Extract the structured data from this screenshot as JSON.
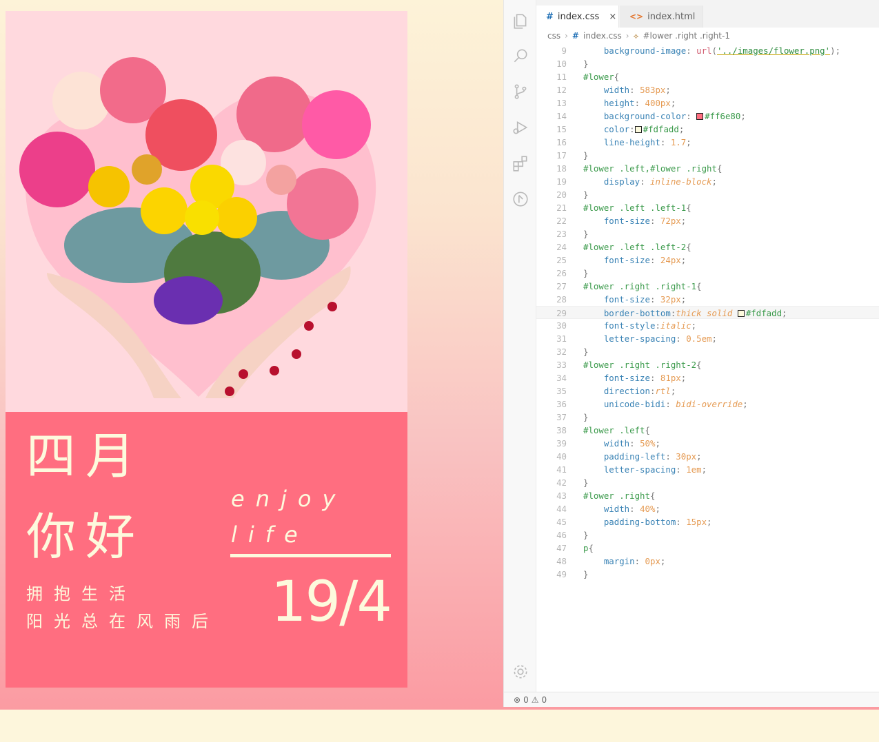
{
  "preview": {
    "left_1": [
      "四月",
      "你好"
    ],
    "left_2": [
      "拥抱生活",
      "阳光总在风雨后"
    ],
    "right_1": [
      "enjoy",
      "life"
    ],
    "right_2": "19/4",
    "colors": {
      "photo_bg": "#ffd9de",
      "card_bg": "#ff6e80",
      "text": "#fdfadd"
    }
  },
  "editor": {
    "tabs": [
      {
        "icon": "#",
        "label": "index.css",
        "close": "×",
        "active": true
      },
      {
        "icon": "<>",
        "label": "index.html",
        "active": false
      }
    ],
    "breadcrumb": [
      "css",
      "index.css",
      "#lower .right .right-1"
    ],
    "lines": [
      {
        "n": "9",
        "tokens": [
          [
            "prop",
            "    background-image"
          ],
          [
            "pun",
            ": "
          ],
          [
            "fn",
            "url"
          ],
          [
            "pun",
            "("
          ],
          [
            "str",
            "'../images/flower.png'"
          ],
          [
            "pun",
            ");"
          ]
        ]
      },
      {
        "n": "10",
        "tokens": [
          [
            "pun",
            "}"
          ]
        ]
      },
      {
        "n": "11",
        "tokens": [
          [
            "sel",
            "#lower"
          ],
          [
            "pun",
            "{"
          ]
        ]
      },
      {
        "n": "12",
        "tokens": [
          [
            "prop",
            "    width"
          ],
          [
            "pun",
            ": "
          ],
          [
            "val",
            "583px"
          ],
          [
            "pun",
            ";"
          ]
        ]
      },
      {
        "n": "13",
        "tokens": [
          [
            "prop",
            "    height"
          ],
          [
            "pun",
            ": "
          ],
          [
            "val",
            "400px"
          ],
          [
            "pun",
            ";"
          ]
        ]
      },
      {
        "n": "14",
        "tokens": [
          [
            "prop",
            "    background-color"
          ],
          [
            "pun",
            ": "
          ],
          [
            "sw",
            "#ff6e80"
          ],
          [
            "hex",
            "#ff6e80"
          ],
          [
            "pun",
            ";"
          ]
        ]
      },
      {
        "n": "15",
        "tokens": [
          [
            "prop",
            "    color"
          ],
          [
            "pun",
            ":"
          ],
          [
            "sw",
            "#fdfadd"
          ],
          [
            "hex",
            "#fdfadd"
          ],
          [
            "pun",
            ";"
          ]
        ]
      },
      {
        "n": "16",
        "tokens": [
          [
            "prop",
            "    line-height"
          ],
          [
            "pun",
            ": "
          ],
          [
            "val",
            "1.7"
          ],
          [
            "pun",
            ";"
          ]
        ]
      },
      {
        "n": "17",
        "tokens": [
          [
            "pun",
            "}"
          ]
        ]
      },
      {
        "n": "18",
        "tokens": [
          [
            "sel",
            "#lower .left,#lower .right"
          ],
          [
            "pun",
            "{"
          ]
        ]
      },
      {
        "n": "19",
        "tokens": [
          [
            "prop",
            "    display"
          ],
          [
            "pun",
            ": "
          ],
          [
            "ital",
            "inline-block"
          ],
          [
            "pun",
            ";"
          ]
        ]
      },
      {
        "n": "20",
        "tokens": [
          [
            "pun",
            "}"
          ]
        ]
      },
      {
        "n": "21",
        "tokens": [
          [
            "sel",
            "#lower .left .left-1"
          ],
          [
            "pun",
            "{"
          ]
        ]
      },
      {
        "n": "22",
        "tokens": [
          [
            "prop",
            "    font-size"
          ],
          [
            "pun",
            ": "
          ],
          [
            "val",
            "72px"
          ],
          [
            "pun",
            ";"
          ]
        ]
      },
      {
        "n": "23",
        "tokens": [
          [
            "pun",
            "}"
          ]
        ]
      },
      {
        "n": "24",
        "tokens": [
          [
            "sel",
            "#lower .left .left-2"
          ],
          [
            "pun",
            "{"
          ]
        ]
      },
      {
        "n": "25",
        "tokens": [
          [
            "prop",
            "    font-size"
          ],
          [
            "pun",
            ": "
          ],
          [
            "val",
            "24px"
          ],
          [
            "pun",
            ";"
          ]
        ]
      },
      {
        "n": "26",
        "tokens": [
          [
            "pun",
            "}"
          ]
        ]
      },
      {
        "n": "27",
        "tokens": [
          [
            "sel",
            "#lower .right .right-1"
          ],
          [
            "pun",
            "{"
          ]
        ]
      },
      {
        "n": "28",
        "tokens": [
          [
            "prop",
            "    font-size"
          ],
          [
            "pun",
            ": "
          ],
          [
            "val",
            "32px"
          ],
          [
            "pun",
            ";"
          ]
        ]
      },
      {
        "n": "29",
        "tokens": [
          [
            "prop",
            "    border-bottom"
          ],
          [
            "pun",
            ":"
          ],
          [
            "ital",
            "thick solid "
          ],
          [
            "sw",
            "#fdfadd"
          ],
          [
            "hex",
            "#fdfadd"
          ],
          [
            "pun",
            ";"
          ]
        ],
        "current": true
      },
      {
        "n": "30",
        "tokens": [
          [
            "prop",
            "    font-style"
          ],
          [
            "pun",
            ":"
          ],
          [
            "ital",
            "italic"
          ],
          [
            "pun",
            ";"
          ]
        ]
      },
      {
        "n": "31",
        "tokens": [
          [
            "prop",
            "    letter-spacing"
          ],
          [
            "pun",
            ": "
          ],
          [
            "val",
            "0.5em"
          ],
          [
            "pun",
            ";"
          ]
        ]
      },
      {
        "n": "32",
        "tokens": [
          [
            "pun",
            "}"
          ]
        ]
      },
      {
        "n": "33",
        "tokens": [
          [
            "sel",
            "#lower .right .right-2"
          ],
          [
            "pun",
            "{"
          ]
        ]
      },
      {
        "n": "34",
        "tokens": [
          [
            "prop",
            "    font-size"
          ],
          [
            "pun",
            ": "
          ],
          [
            "val",
            "81px"
          ],
          [
            "pun",
            ";"
          ]
        ]
      },
      {
        "n": "35",
        "tokens": [
          [
            "prop",
            "    direction"
          ],
          [
            "pun",
            ":"
          ],
          [
            "ital",
            "rtl"
          ],
          [
            "pun",
            ";"
          ]
        ]
      },
      {
        "n": "36",
        "tokens": [
          [
            "prop",
            "    unicode-bidi"
          ],
          [
            "pun",
            ": "
          ],
          [
            "ital",
            "bidi-override"
          ],
          [
            "pun",
            ";"
          ]
        ]
      },
      {
        "n": "37",
        "tokens": [
          [
            "pun",
            "}"
          ]
        ]
      },
      {
        "n": "38",
        "tokens": [
          [
            "sel",
            "#lower .left"
          ],
          [
            "pun",
            "{"
          ]
        ]
      },
      {
        "n": "39",
        "tokens": [
          [
            "prop",
            "    width"
          ],
          [
            "pun",
            ": "
          ],
          [
            "val",
            "50%"
          ],
          [
            "pun",
            ";"
          ]
        ]
      },
      {
        "n": "40",
        "tokens": [
          [
            "prop",
            "    padding-left"
          ],
          [
            "pun",
            ": "
          ],
          [
            "val",
            "30px"
          ],
          [
            "pun",
            ";"
          ]
        ]
      },
      {
        "n": "41",
        "tokens": [
          [
            "prop",
            "    letter-spacing"
          ],
          [
            "pun",
            ": "
          ],
          [
            "val",
            "1em"
          ],
          [
            "pun",
            ";"
          ]
        ]
      },
      {
        "n": "42",
        "tokens": [
          [
            "pun",
            "}"
          ]
        ]
      },
      {
        "n": "43",
        "tokens": [
          [
            "sel",
            "#lower .right"
          ],
          [
            "pun",
            "{"
          ]
        ]
      },
      {
        "n": "44",
        "tokens": [
          [
            "prop",
            "    width"
          ],
          [
            "pun",
            ": "
          ],
          [
            "val",
            "40%"
          ],
          [
            "pun",
            ";"
          ]
        ]
      },
      {
        "n": "45",
        "tokens": [
          [
            "prop",
            "    padding-bottom"
          ],
          [
            "pun",
            ": "
          ],
          [
            "val",
            "15px"
          ],
          [
            "pun",
            ";"
          ]
        ]
      },
      {
        "n": "46",
        "tokens": [
          [
            "pun",
            "}"
          ]
        ]
      },
      {
        "n": "47",
        "tokens": [
          [
            "sel",
            "p"
          ],
          [
            "pun",
            "{"
          ]
        ]
      },
      {
        "n": "48",
        "tokens": [
          [
            "prop",
            "    margin"
          ],
          [
            "pun",
            ": "
          ],
          [
            "val",
            "0px"
          ],
          [
            "pun",
            ";"
          ]
        ]
      },
      {
        "n": "49",
        "tokens": [
          [
            "pun",
            "}"
          ]
        ]
      }
    ]
  },
  "status": {
    "errors": "0",
    "warnings": "0"
  },
  "icons": [
    "explorer-icon",
    "search-icon",
    "source-control-icon",
    "run-debug-icon",
    "extensions-icon",
    "remote-icon",
    "settings-gear-icon"
  ]
}
